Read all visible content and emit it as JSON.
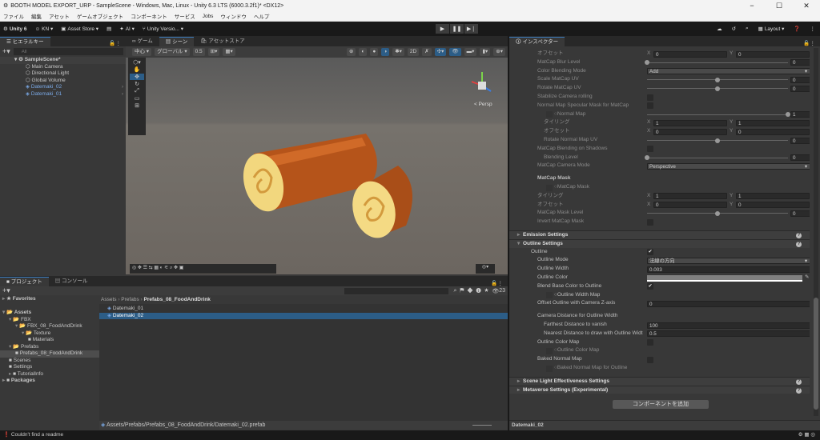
{
  "window": {
    "title": "BOOTH MODEL EXPORT_URP - SampleScene - Windows, Mac, Linux - Unity 6.3 LTS (6000.3.2f1)* <DX12>",
    "minimize": "−",
    "maximize": "☐",
    "close": "✕"
  },
  "menu": [
    "ファイル",
    "編集",
    "アセット",
    "ゲームオブジェクト",
    "コンポーネント",
    "サービス",
    "Jobs",
    "ウィンドウ",
    "ヘルプ"
  ],
  "toolbar": {
    "unity": "Unity 6",
    "account": "KN ▾",
    "asset_store": "Asset Store ▾",
    "ai": "AI ▾",
    "version_control": "Unity Versio... ▾",
    "layout": "Layout ▾"
  },
  "hierarchy": {
    "tab": "ヒエラルキー",
    "search_placeholder": "All",
    "scene": "SampleScene*",
    "items": [
      {
        "name": "Main Camera",
        "prefab": false
      },
      {
        "name": "Directional Light",
        "prefab": false
      },
      {
        "name": "Global Volume",
        "prefab": false
      },
      {
        "name": "Datemaki_02",
        "prefab": true
      },
      {
        "name": "Datemaki_01",
        "prefab": true
      }
    ]
  },
  "scene_tabs": [
    "ゲーム",
    "シーン",
    "アセットストア"
  ],
  "scene_toolbar": {
    "pivot": "中心 ▾",
    "space": "グローバル ▾",
    "snap": "0.5",
    "persp": "< Persp"
  },
  "inspector": {
    "tab": "インスペクター",
    "rows": [
      {
        "t": "vec2",
        "label": "オフセット",
        "x": "0",
        "y": "0",
        "indent": 1
      },
      {
        "t": "slider",
        "label": "MatCap Blur Level",
        "value": "0",
        "frac": 0,
        "indent": 1
      },
      {
        "t": "dropdown",
        "label": "Color Blending Mode",
        "value": "Add",
        "indent": 1
      },
      {
        "t": "slider",
        "label": "Scale MatCap UV",
        "value": "0",
        "frac": 0.5,
        "indent": 1
      },
      {
        "t": "slider",
        "label": "Rotate MatCap UV",
        "value": "0",
        "frac": 0.5,
        "indent": 1
      },
      {
        "t": "check",
        "label": "Stabilize Camera rolling",
        "checked": false,
        "indent": 1
      },
      {
        "t": "check",
        "label": "Normal Map Specular Mask for MatCap",
        "checked": false,
        "indent": 1
      },
      {
        "t": "texslider",
        "label": "○Normal Map",
        "value": "1",
        "frac": 1,
        "indent": 2
      },
      {
        "t": "vec2",
        "label": "タイリング",
        "x": "1",
        "y": "1",
        "indent": 2
      },
      {
        "t": "vec2",
        "label": "オフセット",
        "x": "0",
        "y": "0",
        "indent": 2
      },
      {
        "t": "slider",
        "label": "Rotate Normal Map UV",
        "value": "0",
        "frac": 0.5,
        "indent": 2
      },
      {
        "t": "check",
        "label": "MatCap Blending on Shadows",
        "checked": false,
        "indent": 1
      },
      {
        "t": "slider",
        "label": "Blending Level",
        "value": "0",
        "frac": 0,
        "indent": 2
      },
      {
        "t": "dropdown",
        "label": "MatCap Camera Mode",
        "value": "Perspective",
        "indent": 1
      },
      {
        "t": "gap"
      },
      {
        "t": "label",
        "label": "MatCap Mask",
        "indent": 1,
        "bold": true
      },
      {
        "t": "tex",
        "label": "○MatCap Mask",
        "indent": 2
      },
      {
        "t": "vec2",
        "label": "タイリング",
        "x": "1",
        "y": "1",
        "indent": 1
      },
      {
        "t": "vec2",
        "label": "オフセット",
        "x": "0",
        "y": "0",
        "indent": 1
      },
      {
        "t": "slider",
        "label": "MatCap Mask Level",
        "value": "0",
        "frac": 0.5,
        "indent": 1
      },
      {
        "t": "check",
        "label": "Invert MatCap Mask",
        "checked": false,
        "indent": 1
      },
      {
        "t": "gap"
      },
      {
        "t": "header",
        "label": "Emission Settings",
        "open": false
      },
      {
        "t": "header",
        "label": "Outline Settings",
        "open": true
      },
      {
        "t": "check",
        "label": "Outline",
        "checked": true,
        "indent": 0,
        "bright": true
      },
      {
        "t": "dropdown",
        "label": "Outline Mode",
        "value": "法線の方向",
        "indent": 1,
        "bright": true
      },
      {
        "t": "field",
        "label": "Outline Width",
        "value": "0.003",
        "indent": 1,
        "bright": true
      },
      {
        "t": "color",
        "label": "Outline Color",
        "indent": 1,
        "bright": true,
        "color": "#808080"
      },
      {
        "t": "check",
        "label": "Blend Base Color to Outline",
        "checked": true,
        "indent": 1,
        "bright": true
      },
      {
        "t": "tex",
        "label": "○Outline Width Map",
        "indent": 2,
        "bright": true
      },
      {
        "t": "field",
        "label": "Offset Outline with Camera Z-axis",
        "value": "0",
        "indent": 1,
        "bright": true
      },
      {
        "t": "gap"
      },
      {
        "t": "label",
        "label": "Camera Distance for Outline Width",
        "indent": 1,
        "bright": true
      },
      {
        "t": "field",
        "label": "Farthest Distance to vanish",
        "value": "100",
        "indent": 2,
        "bright": true
      },
      {
        "t": "field",
        "label": "Nearest Distance to draw with Outline Widt",
        "value": "0.5",
        "indent": 2,
        "bright": true
      },
      {
        "t": "check",
        "label": "Outline Color Map",
        "checked": false,
        "indent": 1,
        "bright": true
      },
      {
        "t": "tex",
        "label": "○Outline Color Map",
        "indent": 2
      },
      {
        "t": "check",
        "label": "Baked Normal Map",
        "checked": false,
        "indent": 1,
        "bright": true
      },
      {
        "t": "tex",
        "label": "○Baked Normal Map for Outline",
        "indent": 2
      },
      {
        "t": "gap"
      },
      {
        "t": "header",
        "label": "Scene Light Effectiveness Settings",
        "open": false
      },
      {
        "t": "header",
        "label": "Metaverse Settings (Experimental)",
        "open": false
      }
    ],
    "add_component": "コンポーネントを追加",
    "footer": "Datemaki_02"
  },
  "project": {
    "tabs": [
      "プロジェクト",
      "コンソール"
    ],
    "count": "23",
    "breadcrumb": [
      "Assets",
      "Prefabs",
      "Prefabs_08_FoodAndDrink"
    ],
    "tree": [
      {
        "name": "Favorites",
        "lvl": 0,
        "arrow": "▸",
        "icon": "★"
      },
      {
        "name": "",
        "lvl": 0,
        "arrow": "",
        "icon": ""
      },
      {
        "name": "Assets",
        "lvl": 0,
        "arrow": "▾",
        "icon": "📂"
      },
      {
        "name": "FBX",
        "lvl": 1,
        "arrow": "▾",
        "icon": "📂"
      },
      {
        "name": "FBX_08_FoodAndDrink",
        "lvl": 2,
        "arrow": "▾",
        "icon": "📂"
      },
      {
        "name": "Texture",
        "lvl": 3,
        "arrow": "▾",
        "icon": "📂"
      },
      {
        "name": "Materials",
        "lvl": 4,
        "arrow": "",
        "icon": "■"
      },
      {
        "name": "Prefabs",
        "lvl": 1,
        "arrow": "▾",
        "icon": "📂"
      },
      {
        "name": "Prefabs_08_FoodAndDrink",
        "lvl": 2,
        "arrow": "",
        "icon": "■",
        "selected": true
      },
      {
        "name": "Scenes",
        "lvl": 1,
        "arrow": "",
        "icon": "■"
      },
      {
        "name": "Settings",
        "lvl": 1,
        "arrow": "",
        "icon": "■"
      },
      {
        "name": "TutorialInfo",
        "lvl": 1,
        "arrow": "▸",
        "icon": "■"
      },
      {
        "name": "Packages",
        "lvl": 0,
        "arrow": "▸",
        "icon": "■"
      }
    ],
    "files": [
      {
        "name": "Datemaki_01",
        "selected": false
      },
      {
        "name": "Datemaki_02",
        "selected": true
      }
    ],
    "path": "Assets/Prefabs/Prefabs_08_FoodAndDrink/Datemaki_02.prefab"
  },
  "status": "Couldn't find a readme",
  "colors": {
    "accent": "#3a79bb",
    "selection": "#2c5d87"
  }
}
